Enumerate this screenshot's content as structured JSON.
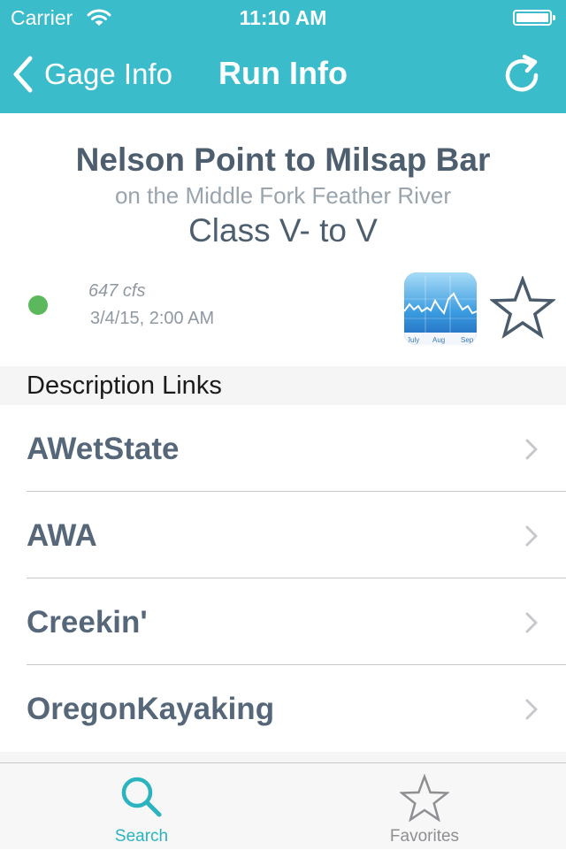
{
  "status_bar": {
    "carrier": "Carrier",
    "time": "11:10 AM"
  },
  "nav": {
    "back_label": "Gage Info",
    "title": "Run Info"
  },
  "run": {
    "name": "Nelson Point to Milsap Bar",
    "river": "on the Middle Fork Feather River",
    "class": "Class V- to V"
  },
  "flow": {
    "value": "647 cfs",
    "timestamp": "3/4/15, 2:00 AM",
    "status_color": "#5cb85c",
    "graph_months": [
      "July",
      "Aug",
      "Sep"
    ]
  },
  "sections": {
    "description_links": "Description Links"
  },
  "links": [
    {
      "label": "AWetState"
    },
    {
      "label": "AWA"
    },
    {
      "label": "Creekin'"
    },
    {
      "label": "OregonKayaking"
    }
  ],
  "tabs": [
    {
      "label": "Search",
      "icon": "search-icon",
      "selected": true
    },
    {
      "label": "Favorites",
      "icon": "star-icon",
      "selected": false
    }
  ],
  "colors": {
    "accent": "#3bbccb",
    "text_primary": "#4d5e6e",
    "tab_active": "#2bb3c0"
  }
}
